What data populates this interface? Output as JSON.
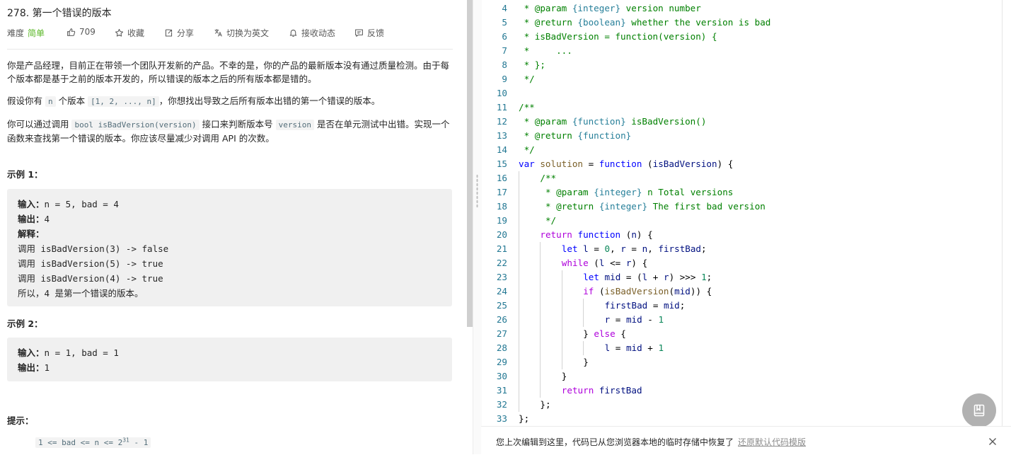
{
  "problem": {
    "title": "278. 第一个错误的版本",
    "difficulty_label": "难度",
    "difficulty_value": "简单",
    "likes": "709",
    "favorite": "收藏",
    "share": "分享",
    "switch_lang": "切换为英文",
    "follow": "接收动态",
    "feedback": "反馈"
  },
  "description": {
    "p1": "你是产品经理，目前正在带领一个团队开发新的产品。不幸的是，你的产品的最新版本没有通过质量检测。由于每个版本都是基于之前的版本开发的，所以错误的版本之后的所有版本都是错的。",
    "p2_a": "假设你有 ",
    "p2_code1": "n",
    "p2_b": " 个版本 ",
    "p2_code2": "[1, 2, ..., n]",
    "p2_c": "，你想找出导致之后所有版本出错的第一个错误的版本。",
    "p3_a": "你可以通过调用 ",
    "p3_code1": "bool isBadVersion(version)",
    "p3_b": " 接口来判断版本号 ",
    "p3_code2": "version",
    "p3_c": " 是否在单元测试中出错。实现一个函数来查找第一个错误的版本。你应该尽量减少对调用 API 的次数。"
  },
  "example1": {
    "title": "示例 1：",
    "input_label": "输入：",
    "input_value": "n = 5, bad = 4",
    "output_label": "输出：",
    "output_value": "4",
    "explain_label": "解释：",
    "lines": [
      "调用 isBadVersion(3) -> false",
      "调用 isBadVersion(5) -> true",
      "调用 isBadVersion(4) -> true",
      "所以，4 是第一个错误的版本。"
    ]
  },
  "example2": {
    "title": "示例 2：",
    "input_label": "输入：",
    "input_value": "n = 1, bad = 1",
    "output_label": "输出：",
    "output_value": "1"
  },
  "hints": {
    "title": "提示：",
    "item1_base": "1 <= bad <= n <= 2",
    "item1_exp": "31",
    "item1_tail": " - 1"
  },
  "editor": {
    "lines": [
      {
        "n": "4",
        "indent": 0,
        "tokens": [
          [
            " * ",
            "c"
          ],
          [
            "@param",
            "c"
          ],
          [
            " ",
            "c"
          ],
          [
            "{integer}",
            "jt"
          ],
          [
            " version number",
            "c"
          ]
        ]
      },
      {
        "n": "5",
        "indent": 0,
        "tokens": [
          [
            " * ",
            "c"
          ],
          [
            "@return",
            "c"
          ],
          [
            " ",
            "c"
          ],
          [
            "{boolean}",
            "jt"
          ],
          [
            " whether the version is bad",
            "c"
          ]
        ]
      },
      {
        "n": "6",
        "indent": 0,
        "tokens": [
          [
            " * isBadVersion = function(version) {",
            "c"
          ]
        ]
      },
      {
        "n": "7",
        "indent": 0,
        "tokens": [
          [
            " *     ...",
            "c"
          ]
        ]
      },
      {
        "n": "8",
        "indent": 0,
        "tokens": [
          [
            " * };",
            "c"
          ]
        ]
      },
      {
        "n": "9",
        "indent": 0,
        "tokens": [
          [
            " */",
            "c"
          ]
        ]
      },
      {
        "n": "10",
        "indent": 0,
        "tokens": []
      },
      {
        "n": "11",
        "indent": 0,
        "tokens": [
          [
            "/**",
            "c"
          ]
        ]
      },
      {
        "n": "12",
        "indent": 0,
        "tokens": [
          [
            " * ",
            "c"
          ],
          [
            "@param",
            "c"
          ],
          [
            " ",
            "c"
          ],
          [
            "{function}",
            "jt"
          ],
          [
            " isBadVersion()",
            "c"
          ]
        ]
      },
      {
        "n": "13",
        "indent": 0,
        "tokens": [
          [
            " * ",
            "c"
          ],
          [
            "@return",
            "c"
          ],
          [
            " ",
            "c"
          ],
          [
            "{function}",
            "jt"
          ]
        ]
      },
      {
        "n": "14",
        "indent": 0,
        "tokens": [
          [
            " */",
            "c"
          ]
        ]
      },
      {
        "n": "15",
        "indent": 0,
        "tokens": [
          [
            "var",
            "k"
          ],
          [
            " ",
            ""
          ],
          [
            "solution",
            "f"
          ],
          [
            " = ",
            ""
          ],
          [
            "function",
            "k"
          ],
          [
            " (",
            ""
          ],
          [
            "isBadVersion",
            "v"
          ],
          [
            ") {",
            ""
          ]
        ]
      },
      {
        "n": "16",
        "indent": 1,
        "tokens": [
          [
            "/**",
            "c"
          ]
        ]
      },
      {
        "n": "17",
        "indent": 1,
        "tokens": [
          [
            " * ",
            "c"
          ],
          [
            "@param",
            "c"
          ],
          [
            " ",
            "c"
          ],
          [
            "{integer}",
            "jt"
          ],
          [
            " n Total versions",
            "c"
          ]
        ]
      },
      {
        "n": "18",
        "indent": 1,
        "tokens": [
          [
            " * ",
            "c"
          ],
          [
            "@return",
            "c"
          ],
          [
            " ",
            "c"
          ],
          [
            "{integer}",
            "jt"
          ],
          [
            " The first bad version",
            "c"
          ]
        ]
      },
      {
        "n": "19",
        "indent": 1,
        "tokens": [
          [
            " */",
            "c"
          ]
        ]
      },
      {
        "n": "20",
        "indent": 1,
        "tokens": [
          [
            "return",
            "cf"
          ],
          [
            " ",
            ""
          ],
          [
            "function",
            "k"
          ],
          [
            " (",
            ""
          ],
          [
            "n",
            "v"
          ],
          [
            ") {",
            ""
          ]
        ]
      },
      {
        "n": "21",
        "indent": 2,
        "tokens": [
          [
            "let",
            "k"
          ],
          [
            " ",
            ""
          ],
          [
            "l",
            "v"
          ],
          [
            " = ",
            ""
          ],
          [
            "0",
            "n"
          ],
          [
            ", ",
            ""
          ],
          [
            "r",
            "v"
          ],
          [
            " = ",
            ""
          ],
          [
            "n",
            "v"
          ],
          [
            ", ",
            ""
          ],
          [
            "firstBad",
            "v"
          ],
          [
            ";",
            ""
          ]
        ]
      },
      {
        "n": "22",
        "indent": 2,
        "tokens": [
          [
            "while",
            "cf"
          ],
          [
            " (",
            ""
          ],
          [
            "l",
            "v"
          ],
          [
            " <= ",
            ""
          ],
          [
            "r",
            "v"
          ],
          [
            ") {",
            ""
          ]
        ]
      },
      {
        "n": "23",
        "indent": 3,
        "tokens": [
          [
            "let",
            "k"
          ],
          [
            " ",
            ""
          ],
          [
            "mid",
            "v"
          ],
          [
            " = (",
            ""
          ],
          [
            "l",
            "v"
          ],
          [
            " + ",
            ""
          ],
          [
            "r",
            "v"
          ],
          [
            ") >>> ",
            ""
          ],
          [
            "1",
            "n"
          ],
          [
            ";",
            ""
          ]
        ]
      },
      {
        "n": "24",
        "indent": 3,
        "tokens": [
          [
            "if",
            "cf"
          ],
          [
            " (",
            ""
          ],
          [
            "isBadVersion",
            "f"
          ],
          [
            "(",
            ""
          ],
          [
            "mid",
            "v"
          ],
          [
            ")) {",
            ""
          ]
        ]
      },
      {
        "n": "25",
        "indent": 4,
        "tokens": [
          [
            "firstBad",
            "v"
          ],
          [
            " = ",
            ""
          ],
          [
            "mid",
            "v"
          ],
          [
            ";",
            ""
          ]
        ]
      },
      {
        "n": "26",
        "indent": 4,
        "tokens": [
          [
            "r",
            "v"
          ],
          [
            " = ",
            ""
          ],
          [
            "mid",
            "v"
          ],
          [
            " - ",
            ""
          ],
          [
            "1",
            "n"
          ]
        ]
      },
      {
        "n": "27",
        "indent": 3,
        "tokens": [
          [
            "} ",
            ""
          ],
          [
            "else",
            "cf"
          ],
          [
            " {",
            ""
          ]
        ]
      },
      {
        "n": "28",
        "indent": 4,
        "tokens": [
          [
            "l",
            "v"
          ],
          [
            " = ",
            ""
          ],
          [
            "mid",
            "v"
          ],
          [
            " + ",
            ""
          ],
          [
            "1",
            "n"
          ]
        ]
      },
      {
        "n": "29",
        "indent": 3,
        "tokens": [
          [
            "}",
            ""
          ]
        ]
      },
      {
        "n": "30",
        "indent": 2,
        "tokens": [
          [
            "}",
            ""
          ]
        ]
      },
      {
        "n": "31",
        "indent": 2,
        "tokens": [
          [
            "return",
            "cf"
          ],
          [
            " ",
            ""
          ],
          [
            "firstBad",
            "v"
          ]
        ]
      },
      {
        "n": "32",
        "indent": 1,
        "tokens": [
          [
            "};",
            ""
          ]
        ]
      },
      {
        "n": "33",
        "indent": 0,
        "tokens": [
          [
            "};",
            ""
          ]
        ]
      }
    ]
  },
  "restore_bar": {
    "message": "您上次编辑到这里，代码已从您浏览器本地的临时存储中恢复了",
    "link": "还原默认代码模版"
  },
  "icons": {
    "like": "thumbs-up-icon",
    "favorite": "star-icon",
    "share": "share-icon",
    "translate": "translate-icon",
    "bell": "bell-icon",
    "feedback": "feedback-icon",
    "float": "book-icon",
    "close": "close-icon"
  }
}
